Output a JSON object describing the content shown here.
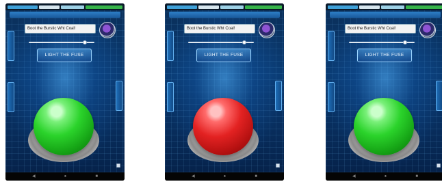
{
  "screenshots": [
    {
      "title": "",
      "field_label": "",
      "text_value": "Boot the Burstic Wht Coal!",
      "slider_label": "",
      "slider_value": 0.88,
      "fuse_button_label": "LIGHT THE FUSE",
      "left_tab_1": "",
      "left_tab_2": "",
      "right_tab": "",
      "big_button_color": "green",
      "nav_icons": [
        "back-icon",
        "home-icon",
        "recent-apps-icon"
      ]
    },
    {
      "title": "",
      "field_label": "",
      "text_value": "Boot the Burstic Wht Coal!",
      "slider_label": "",
      "slider_value": 0.88,
      "fuse_button_label": "LIGHT THE FUSE",
      "left_tab_1": "",
      "left_tab_2": "",
      "right_tab": "",
      "big_button_color": "red",
      "nav_icons": [
        "back-icon",
        "home-icon",
        "recent-apps-icon"
      ]
    },
    {
      "title": "",
      "field_label": "",
      "text_value": "Boot the Burstic Wht Coal!",
      "slider_label": "",
      "slider_value": 0.88,
      "fuse_button_label": "LIGHT THE FUSE",
      "left_tab_1": "",
      "left_tab_2": "",
      "right_tab": "",
      "big_button_color": "green",
      "nav_icons": [
        "back-icon",
        "home-icon",
        "recent-apps-icon"
      ]
    }
  ],
  "colors": {
    "green_button": "#2bd32b",
    "red_button": "#e32222",
    "ui_blue": "#1a5a9c"
  }
}
